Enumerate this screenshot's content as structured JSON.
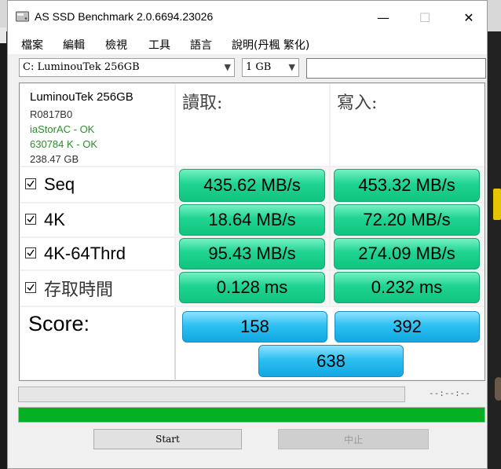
{
  "window": {
    "title": "AS SSD Benchmark 2.0.6694.23026",
    "minimize_glyph": "—",
    "maximize_glyph": "☐",
    "close_glyph": "✕"
  },
  "menu": [
    "檔案",
    "編輯",
    "檢視",
    "工具",
    "語言",
    "說明(丹楓 繁化)"
  ],
  "toolbar": {
    "drive": "C: LuminouTek 256GB",
    "size": "1 GB",
    "text": ""
  },
  "drive_info": {
    "name": "LuminouTek 256GB",
    "firmware": "R0817B0",
    "driver": "iaStorAC - OK",
    "alignment": "630784 K - OK",
    "capacity": "238.47 GB"
  },
  "columns": {
    "read": "讀取:",
    "write": "寫入:"
  },
  "tests": [
    {
      "label": "Seq",
      "read": "435.62 MB/s",
      "write": "453.32 MB/s",
      "checked": true
    },
    {
      "label": "4K",
      "read": "18.64 MB/s",
      "write": "72.20 MB/s",
      "checked": true
    },
    {
      "label": "4K-64Thrd",
      "read": "95.43 MB/s",
      "write": "274.09 MB/s",
      "checked": true
    },
    {
      "label": "存取時間",
      "read": "0.128 ms",
      "write": "0.232 ms",
      "checked": true
    }
  ],
  "score": {
    "label": "Score:",
    "read": "158",
    "write": "392",
    "total": "638"
  },
  "progress": {
    "time": "--:--:--",
    "total_fraction": 1.0
  },
  "buttons": {
    "start": "Start",
    "abort": "中止"
  },
  "colors": {
    "value_green": "#1fd491",
    "score_blue": "#2ec0f2",
    "progress_green": "#06b025",
    "status_ok": "#2e8b2e"
  }
}
